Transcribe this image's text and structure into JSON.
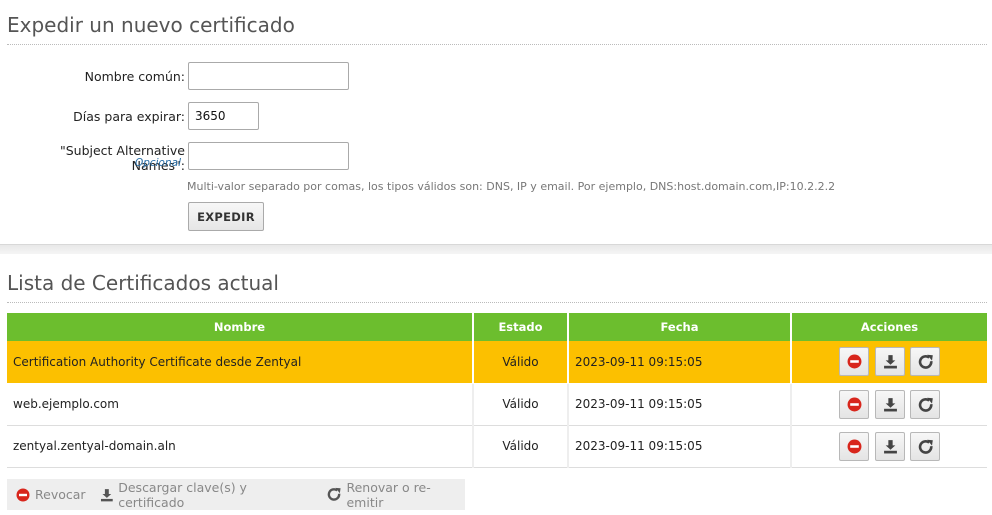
{
  "issue_section": {
    "title": "Expedir un nuevo certificado",
    "common_name_label": "Nombre común:",
    "common_name_value": "",
    "days_label": "Días para expirar:",
    "days_value": "3650",
    "san_label": "\"Subject Alternative Names\":",
    "san_optional": "Opcional",
    "san_value": "",
    "san_hint": "Multi-valor separado por comas, los tipos válidos son: DNS, IP y email. Por ejemplo, DNS:host.domain.com,IP:10.2.2.2",
    "submit_label": "EXPEDIR"
  },
  "list_section": {
    "title": "Lista de Certificados actual",
    "columns": [
      "Nombre",
      "Estado",
      "Fecha",
      "Acciones"
    ],
    "rows": [
      {
        "name": "Certification Authority Certificate desde Zentyal",
        "status": "Válido",
        "date": "2023-09-11 09:15:05",
        "highlighted": true
      },
      {
        "name": "web.ejemplo.com",
        "status": "Válido",
        "date": "2023-09-11 09:15:05",
        "highlighted": false
      },
      {
        "name": "zentyal.zentyal-domain.aln",
        "status": "Válido",
        "date": "2023-09-11 09:15:05",
        "highlighted": false
      }
    ]
  },
  "legend": {
    "revoke": "Revocar",
    "download": "Descargar clave(s) y certificado",
    "renew": "Renovar o re-emitir"
  },
  "colors": {
    "header_green": "#6cbe2e",
    "highlight_row": "#fcc000",
    "revoke_red": "#d8261c",
    "hint_blue": "#2a6ea6"
  },
  "icons": {
    "revoke": "revoke-icon",
    "download": "download-icon",
    "renew": "renew-icon"
  }
}
